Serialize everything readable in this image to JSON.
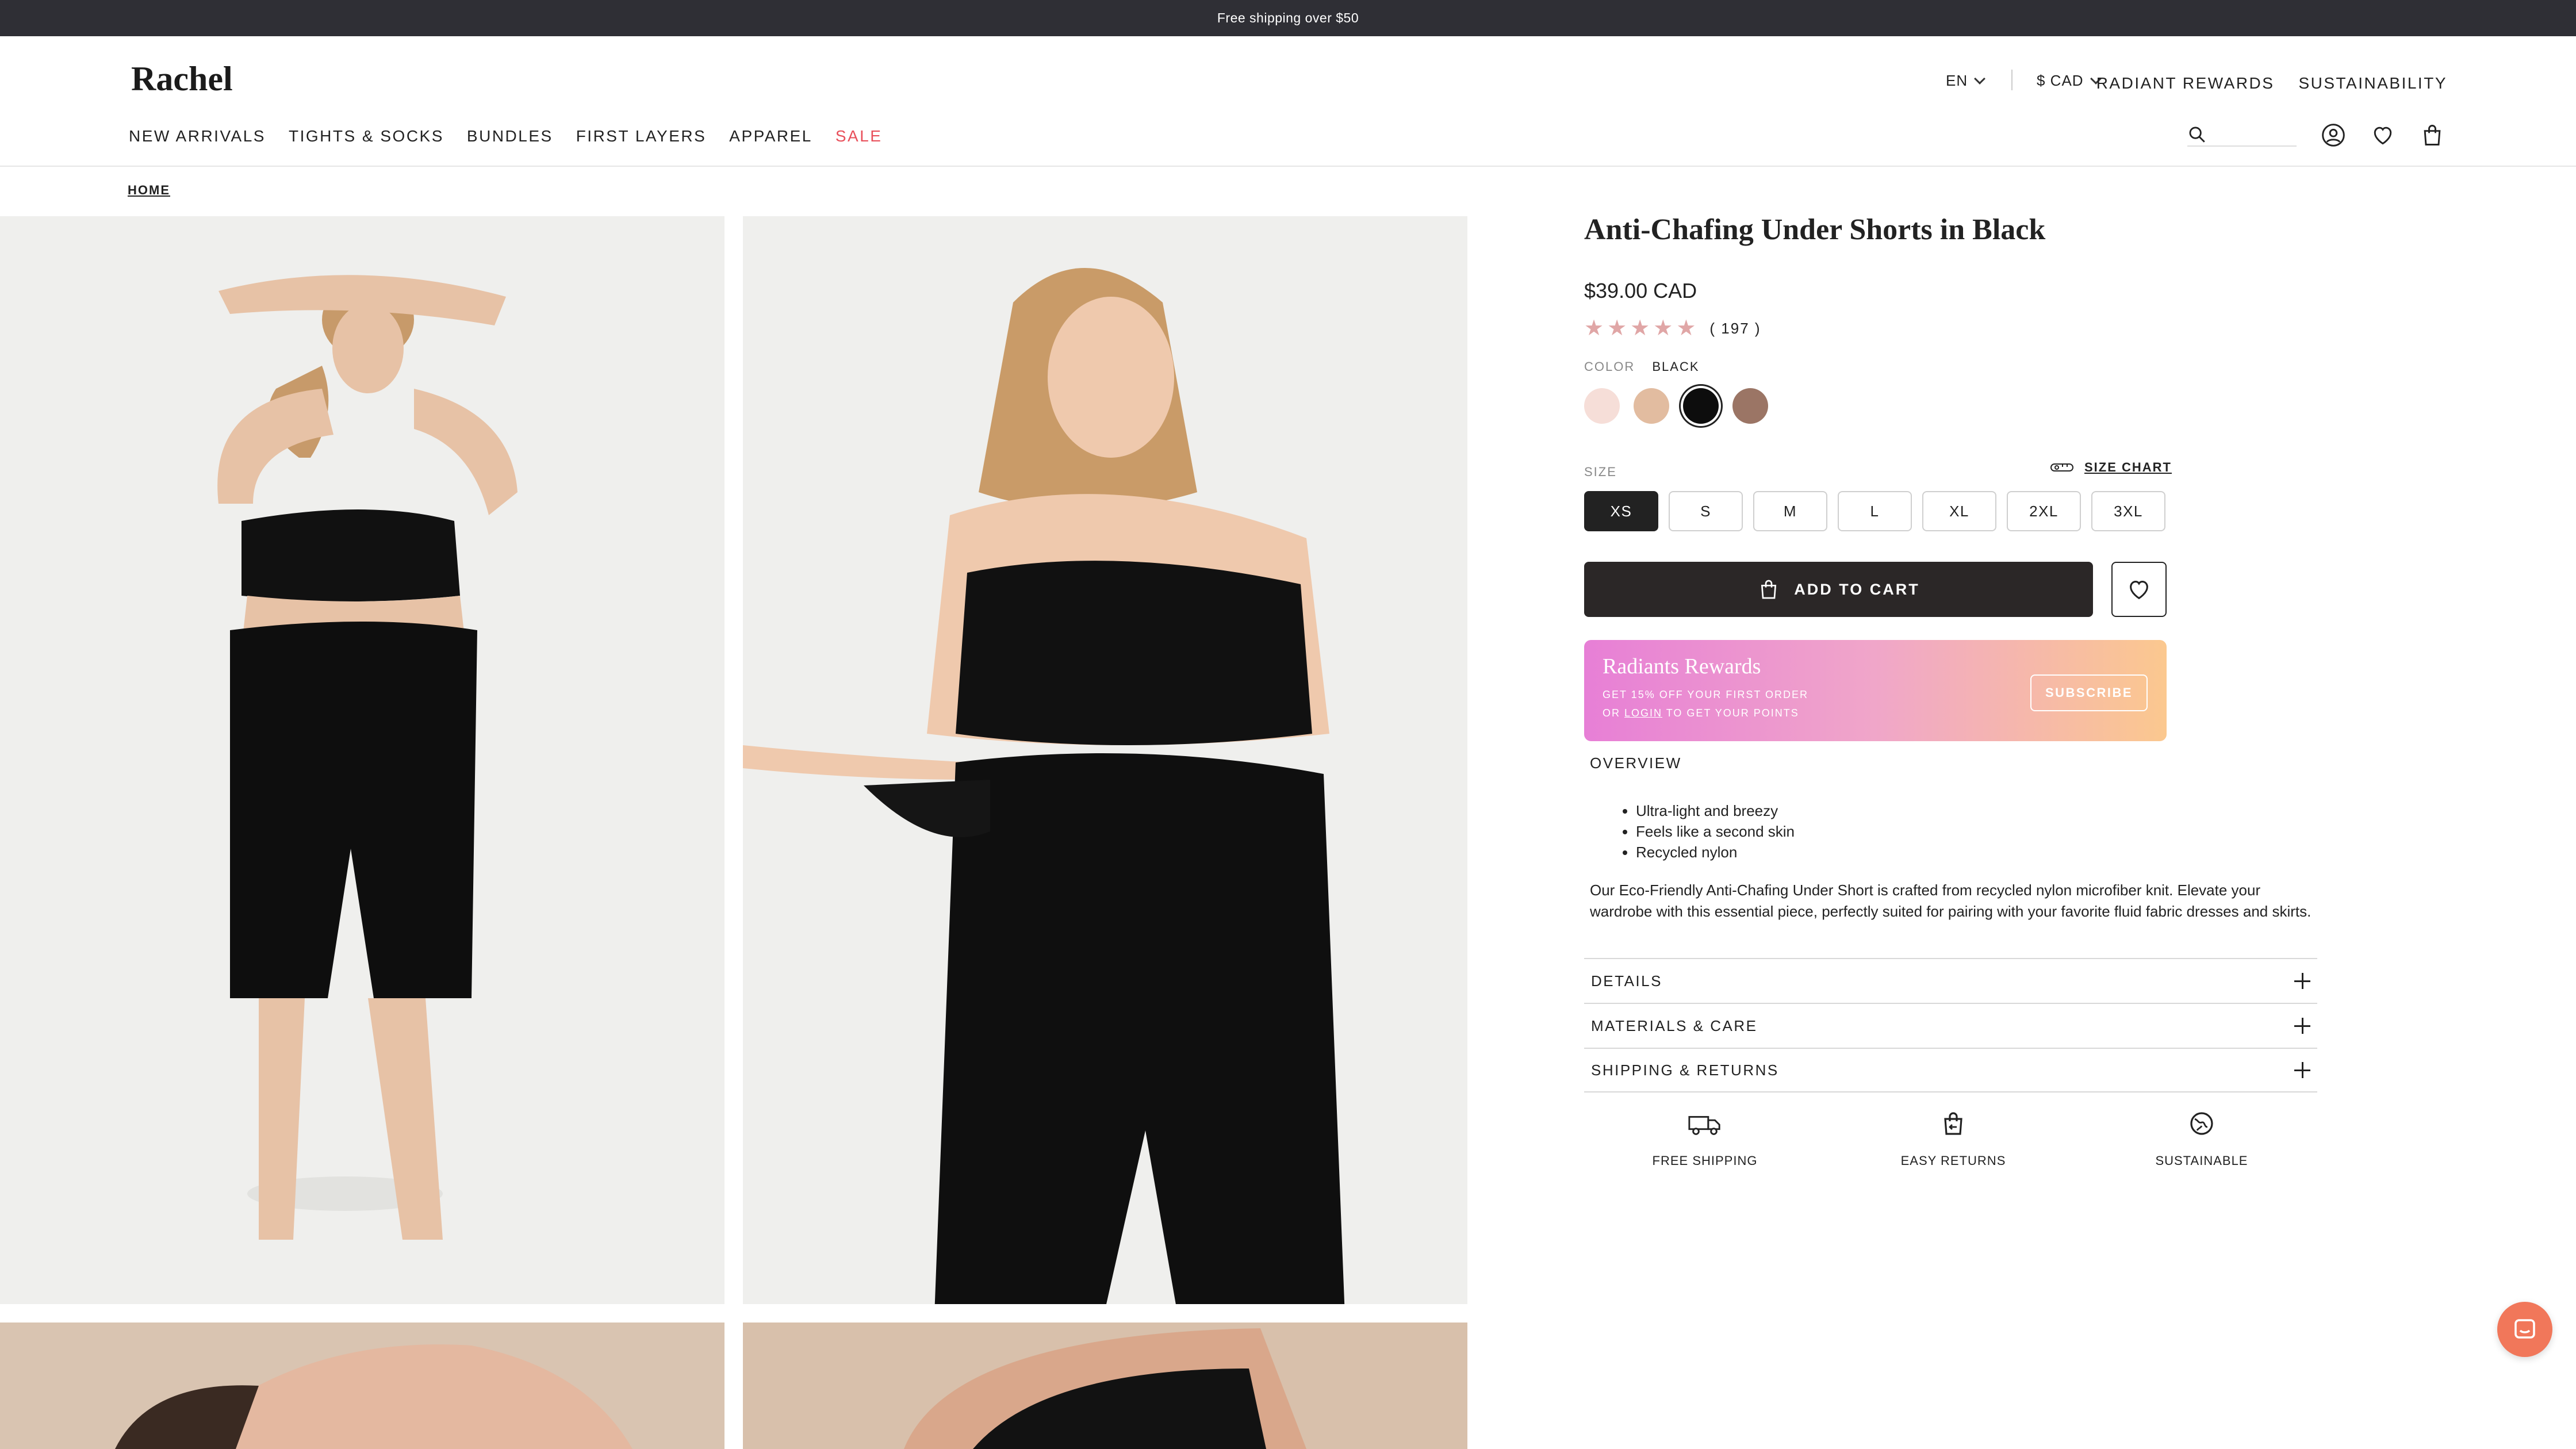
{
  "announcement": "Free shipping over $50",
  "brand": "Rachel",
  "nav": {
    "items": [
      "NEW ARRIVALS",
      "TIGHTS & SOCKS",
      "BUNDLES",
      "FIRST LAYERS",
      "APPAREL",
      "SALE"
    ],
    "sale_color": "#e8505b"
  },
  "utility": {
    "language": "EN",
    "currency": "$ CAD",
    "links": [
      "RADIANT REWARDS",
      "SUSTAINABILITY"
    ]
  },
  "header_icons": [
    "search-icon",
    "account-icon",
    "heart-icon",
    "bag-icon"
  ],
  "breadcrumb": "HOME",
  "product": {
    "title": "Anti-Chafing Under Shorts in Black",
    "price": "$39.00 CAD",
    "rating": 5,
    "reviews": "( 197 )",
    "color_label": "COLOR",
    "color_value": "BLACK",
    "swatches": [
      {
        "name": "blush",
        "hex": "#f6ded8",
        "selected": false
      },
      {
        "name": "nude",
        "hex": "#e2bca0",
        "selected": false
      },
      {
        "name": "black",
        "hex": "#0d0d0d",
        "selected": true
      },
      {
        "name": "mocha",
        "hex": "#9b7565",
        "selected": false
      }
    ],
    "size_label": "SIZE",
    "size_chart": "SIZE CHART",
    "sizes": [
      "XS",
      "S",
      "M",
      "L",
      "XL",
      "2XL",
      "3XL"
    ],
    "selected_size": "XS",
    "add_to_cart": "ADD TO CART"
  },
  "rewards": {
    "title": "Radiants Rewards",
    "line1": "GET 15% OFF YOUR FIRST ORDER",
    "line2_prefix": "OR",
    "line2_link": "LOGIN",
    "line2_suffix": "TO GET YOUR POINTS",
    "button": "SUBSCRIBE"
  },
  "overview": {
    "heading": "OVERVIEW",
    "bullets": [
      "Ultra-light and breezy",
      "Feels like a second skin",
      "Recycled nylon"
    ],
    "description": "Our Eco-Friendly Anti-Chafing Under Short is crafted from recycled nylon microfiber knit. Elevate your wardrobe with this essential piece, perfectly suited for pairing with your favorite fluid fabric dresses and skirts."
  },
  "accordion": [
    "DETAILS",
    "MATERIALS & CARE",
    "SHIPPING & RETURNS"
  ],
  "features": [
    "FREE SHIPPING",
    "EASY RETURNS",
    "SUSTAINABLE"
  ],
  "colors": {
    "topbar": "#2f2f35",
    "primary": "#2b2727",
    "accent": "#e8505b",
    "star": "#e0a6a6"
  }
}
